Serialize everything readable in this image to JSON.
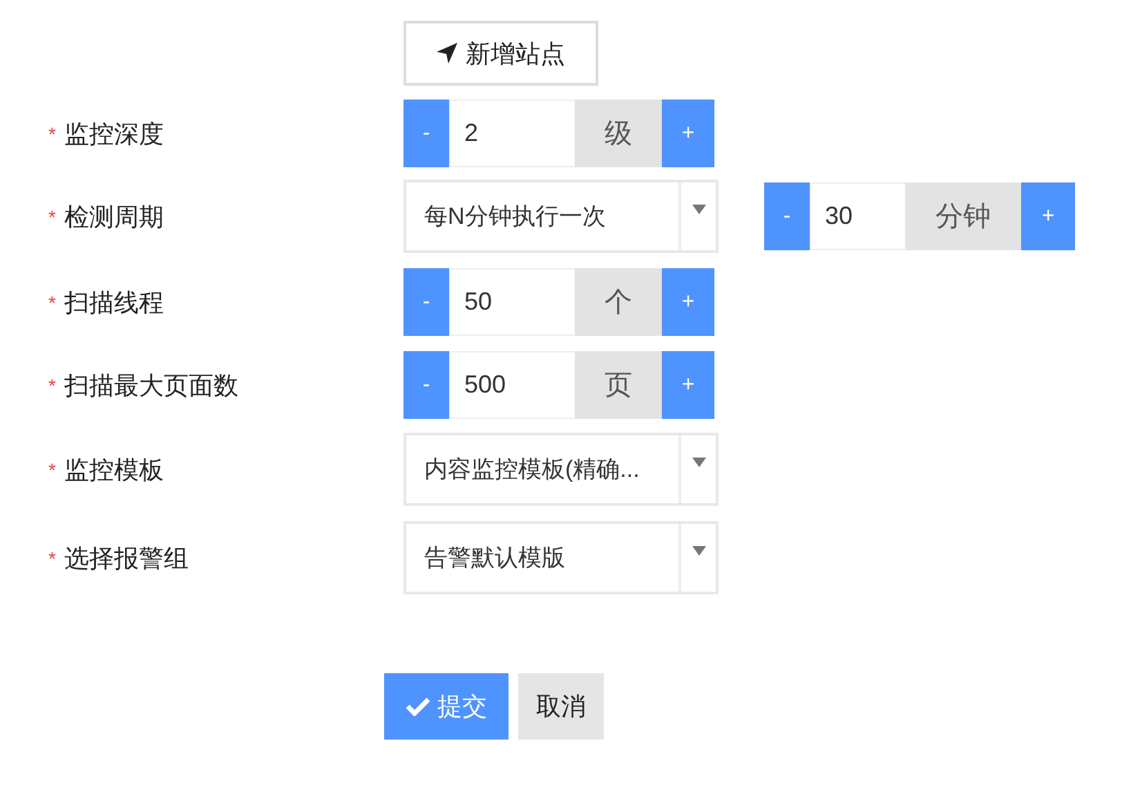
{
  "add_button": {
    "label": "新增站点"
  },
  "fields": [
    {
      "kind": "stepper",
      "required_mark": "*",
      "label": "监控深度",
      "decrement": "-",
      "value": "2",
      "unit": "级",
      "increment": "+"
    },
    {
      "kind": "select_stepper",
      "required_mark": "*",
      "label": "检测周期",
      "selected_option": "每N分钟执行一次",
      "decrement": "-",
      "value": "30",
      "unit": "分钟",
      "increment": "+"
    },
    {
      "kind": "stepper",
      "required_mark": "*",
      "label": "扫描线程",
      "decrement": "-",
      "value": "50",
      "unit": "个",
      "increment": "+"
    },
    {
      "kind": "stepper",
      "required_mark": "*",
      "label": "扫描最大页面数",
      "decrement": "-",
      "value": "500",
      "unit": "页",
      "increment": "+"
    },
    {
      "kind": "select",
      "required_mark": "*",
      "label": "监控模板",
      "selected_option": "内容监控模板(精确..."
    },
    {
      "kind": "select",
      "required_mark": "*",
      "label": "选择报警组",
      "selected_option": "告警默认模版"
    }
  ],
  "actions": {
    "submit": "提交",
    "cancel": "取消"
  }
}
